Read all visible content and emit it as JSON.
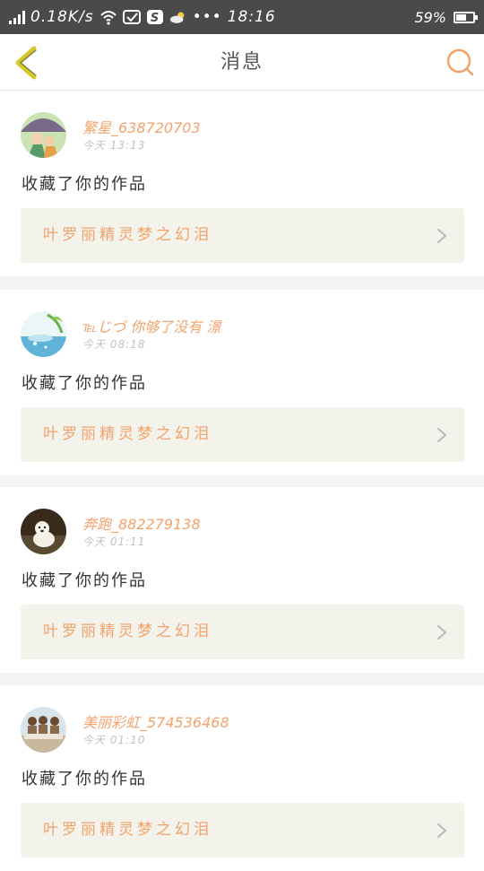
{
  "status_bar": {
    "speed": "0.18K/s",
    "time": "18:16",
    "battery": "59%",
    "battery_level": 0.59,
    "icons": [
      "signal-icon",
      "wifi-icon",
      "message-icon",
      "s-app-icon",
      "weather-icon",
      "more-dots-icon",
      "battery-icon"
    ]
  },
  "header": {
    "title": "消息",
    "back_icon": "chevron-left-icon",
    "search_icon": "search-icon"
  },
  "colors": {
    "accent": "#f2a36b",
    "back_icon": "#d8c72b",
    "status_bar_bg": "#4a4a4a",
    "card_link_bg": "#f3f3ec"
  },
  "notifications": [
    {
      "username": "繁星_638720703",
      "time": "今天 13:13",
      "message": "收藏了你的作品",
      "work_title": "叶罗丽精灵梦之幻泪",
      "avatar": "illustration-avatar"
    },
    {
      "username": "℡じづ 你够了没有 澋",
      "time": "今天 08:18",
      "message": "收藏了你的作品",
      "work_title": "叶罗丽精灵梦之幻泪",
      "avatar": "bamboo-water-avatar"
    },
    {
      "username": "奔跑_882279138",
      "time": "今天 01:11",
      "message": "收藏了你的作品",
      "work_title": "叶罗丽精灵梦之幻泪",
      "avatar": "puppy-avatar"
    },
    {
      "username": "美丽彩虹_574536468",
      "time": "今天 01:10",
      "message": "收藏了你的作品",
      "work_title": "叶罗丽精灵梦之幻泪",
      "avatar": "group-photo-avatar"
    }
  ]
}
